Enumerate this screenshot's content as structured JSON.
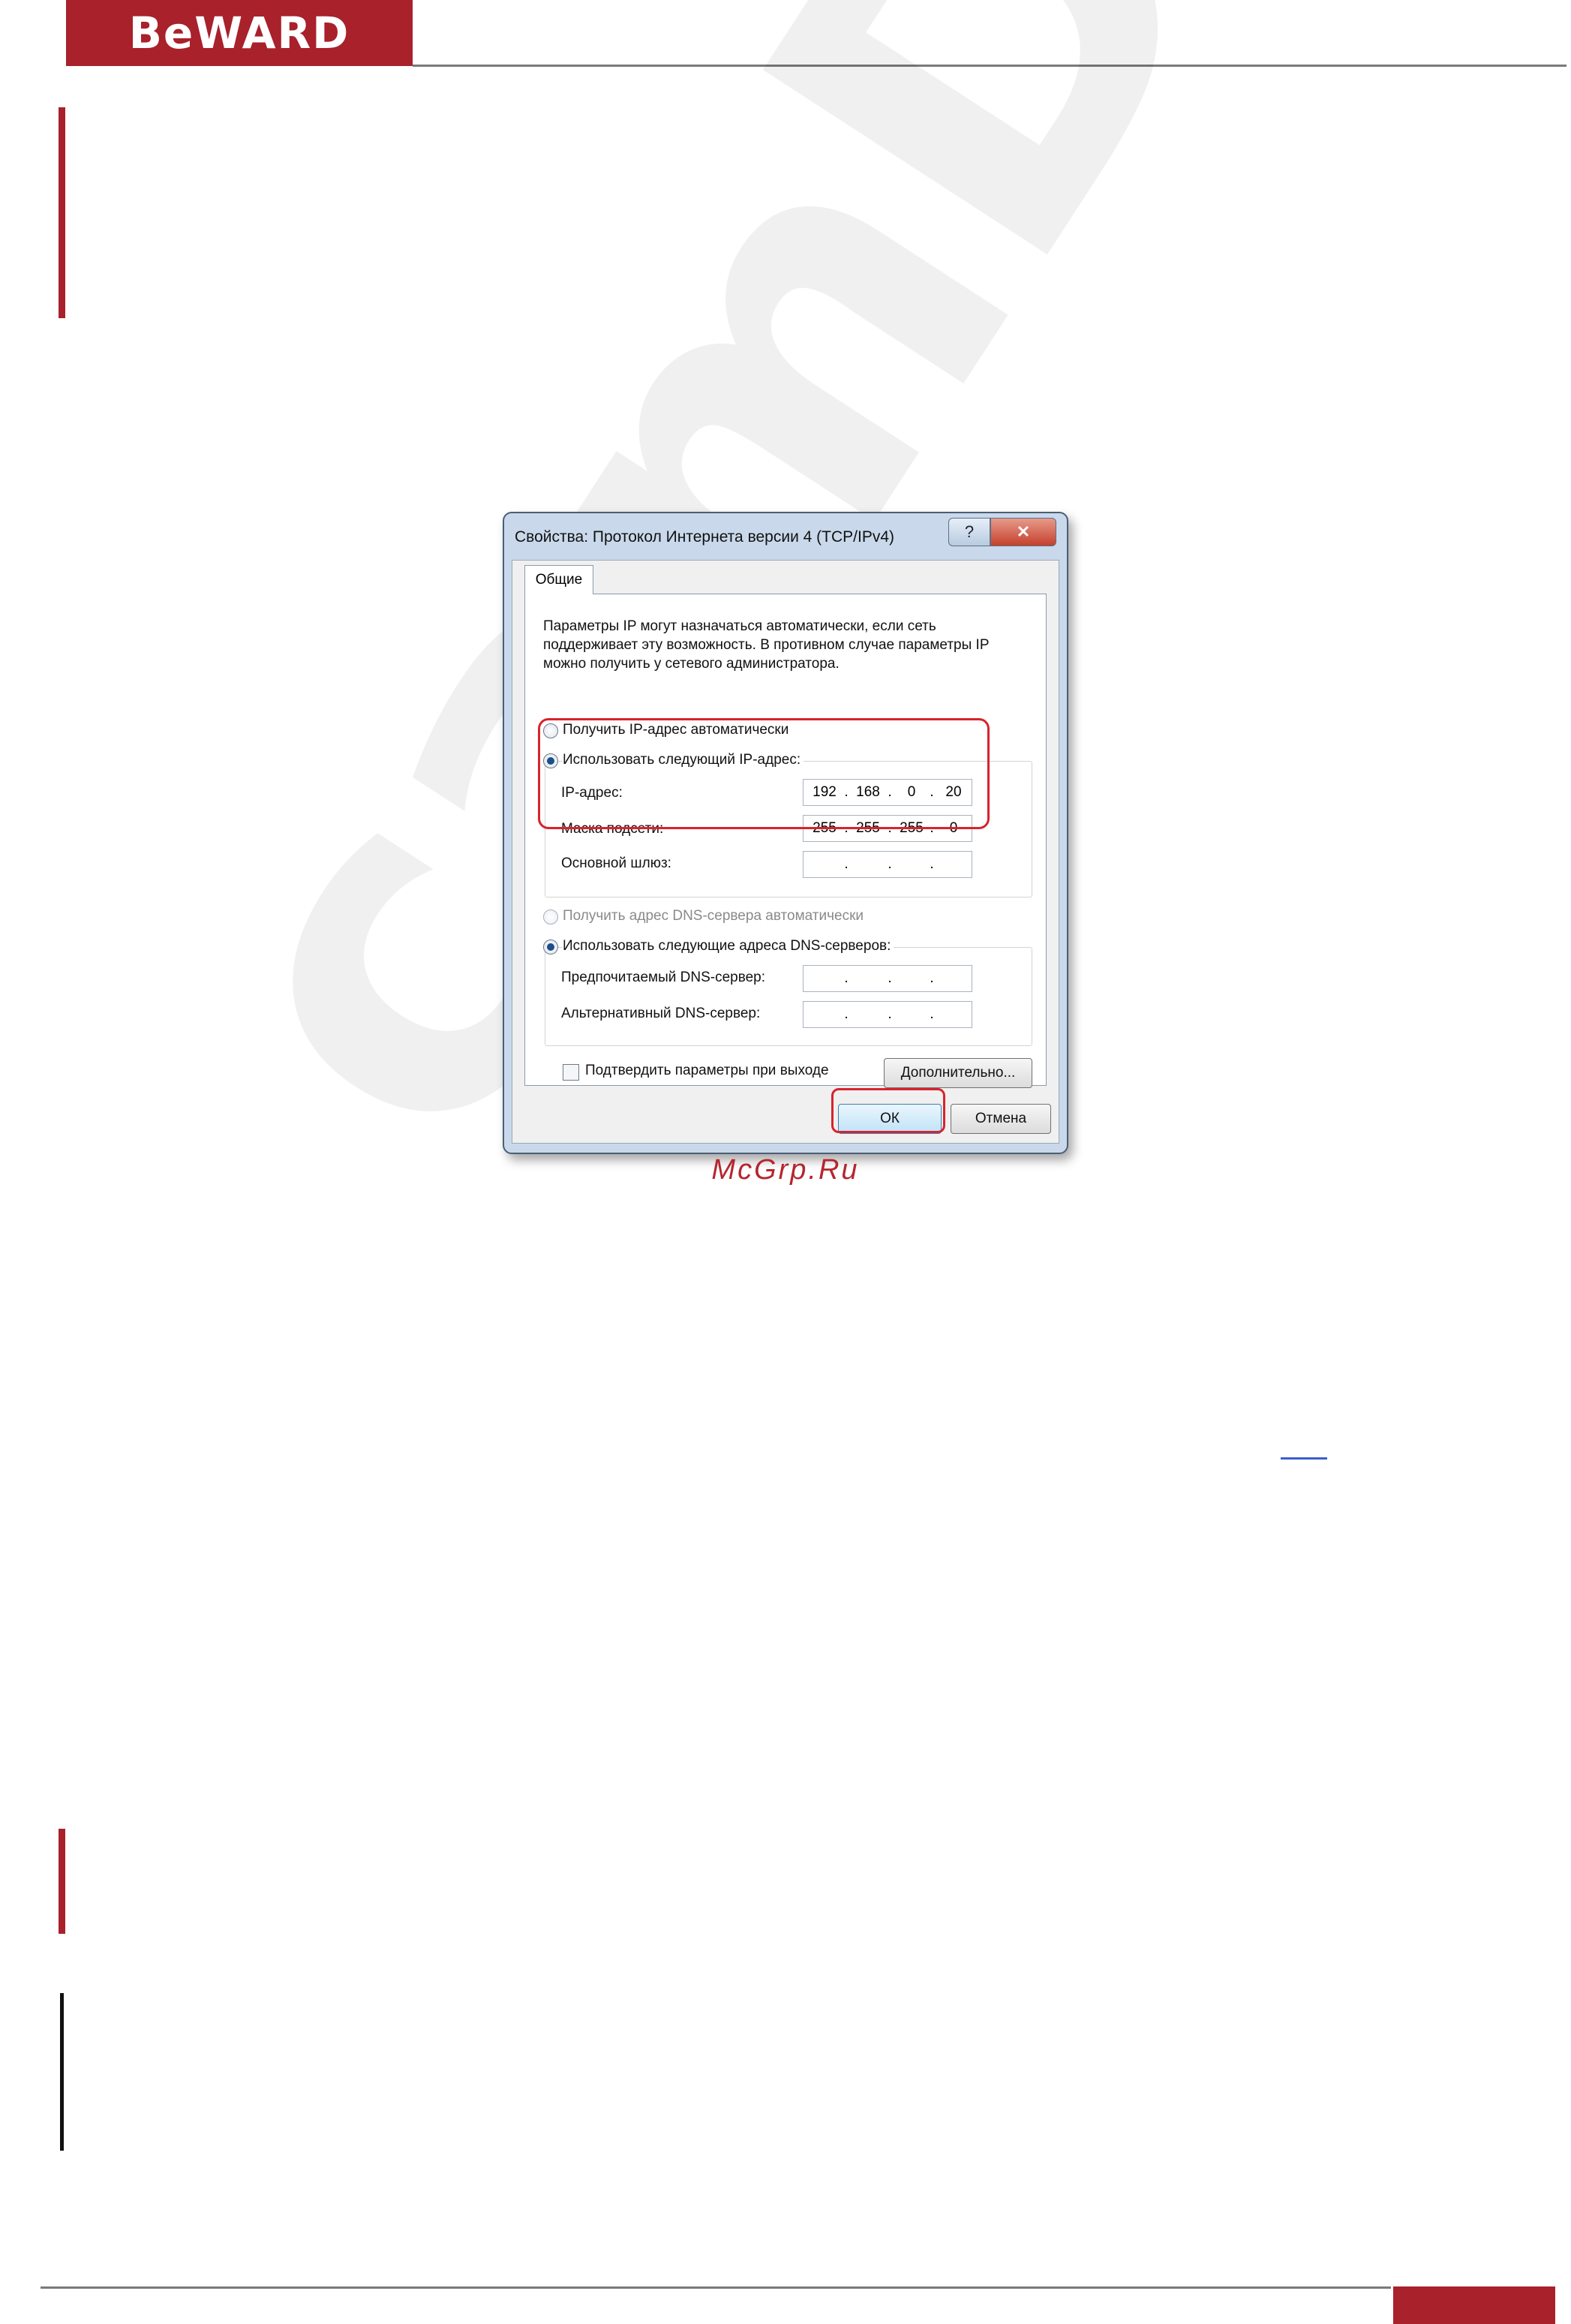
{
  "header": {
    "logo_text": "BeWARD"
  },
  "dialog": {
    "title": "Свойства: Протокол Интернета версии 4 (TCP/IPv4)",
    "help_label": "?",
    "close_label": "✕",
    "tab_label": "Общие",
    "description": "Параметры IP могут назначаться автоматически, если сеть поддерживает эту возможность. В противном случае параметры IP можно получить у сетевого администратора.",
    "radio_auto_ip": "Получить IP-адрес автоматически",
    "radio_manual_ip": "Использовать следующий IP-адрес:",
    "ip_label": "IP-адрес:",
    "ip_octets": [
      "192",
      "168",
      "0",
      "20"
    ],
    "mask_label": "Маска подсети:",
    "mask_octets": [
      "255",
      "255",
      "255",
      "0"
    ],
    "gateway_label": "Основной шлюз:",
    "radio_auto_dns": "Получить адрес DNS-сервера автоматически",
    "radio_manual_dns": "Использовать следующие адреса DNS-серверов:",
    "preferred_dns_label": "Предпочитаемый DNS-сервер:",
    "alternate_dns_label": "Альтернативный DNS-сервер:",
    "validate_label": "Подтвердить параметры при выходе",
    "advanced_label": "Дополнительно...",
    "ok_label": "ОК",
    "cancel_label": "Отмена",
    "separator": "."
  },
  "caption": "McGrp.Ru",
  "watermark": "camDrive",
  "colors": {
    "brand": "#a8212b",
    "highlight": "#d8232d"
  }
}
